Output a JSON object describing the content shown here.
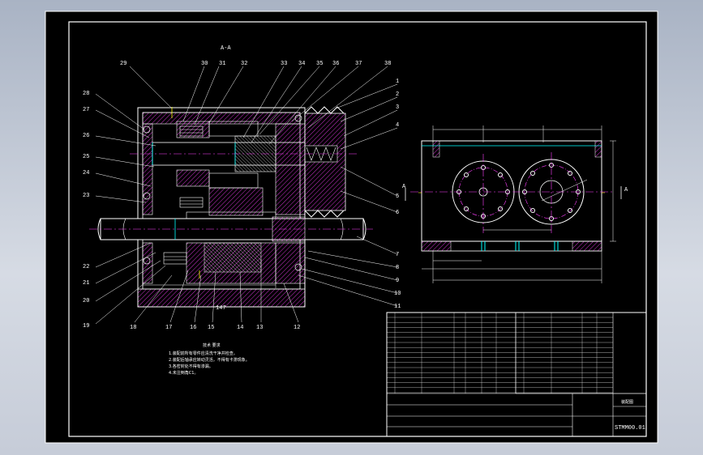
{
  "drawing": {
    "section_title": "A-A",
    "section_marks": [
      "A",
      "A"
    ],
    "callouts_top": [
      "29",
      "30",
      "31",
      "32",
      "33",
      "34",
      "35",
      "36",
      "37",
      "38"
    ],
    "callouts_left": [
      "28",
      "27",
      "26",
      "25",
      "24",
      "23",
      "22",
      "21",
      "20",
      "19"
    ],
    "callouts_right": [
      "1",
      "2",
      "3",
      "4",
      "5",
      "6",
      "7",
      "8",
      "9",
      "10",
      "11"
    ],
    "callouts_bottom": [
      "18",
      "17",
      "16",
      "15",
      "14",
      "13",
      "12"
    ],
    "dims_side": [
      "Φ"
    ],
    "dims_bottom": [
      "147"
    ]
  },
  "notes": {
    "heading": "技术 要求",
    "lines": [
      "1.装配前所有零件应清洗干净并检查。",
      "2.装配后轴承应转动灵活，不得有卡滞现象。",
      "3.各密封处不得有渗漏。",
      "4.未注倒角C1。"
    ]
  },
  "title_block": {
    "drawing_no": "STMM00.01",
    "name": "装配图"
  },
  "colors": {
    "background": "#000000",
    "line": "#ffffff",
    "hatch": "#ff40ff",
    "center": "#ff40ff",
    "highlight": "#00ffff",
    "dim": "#ffffff",
    "accent": "#ffff00"
  }
}
